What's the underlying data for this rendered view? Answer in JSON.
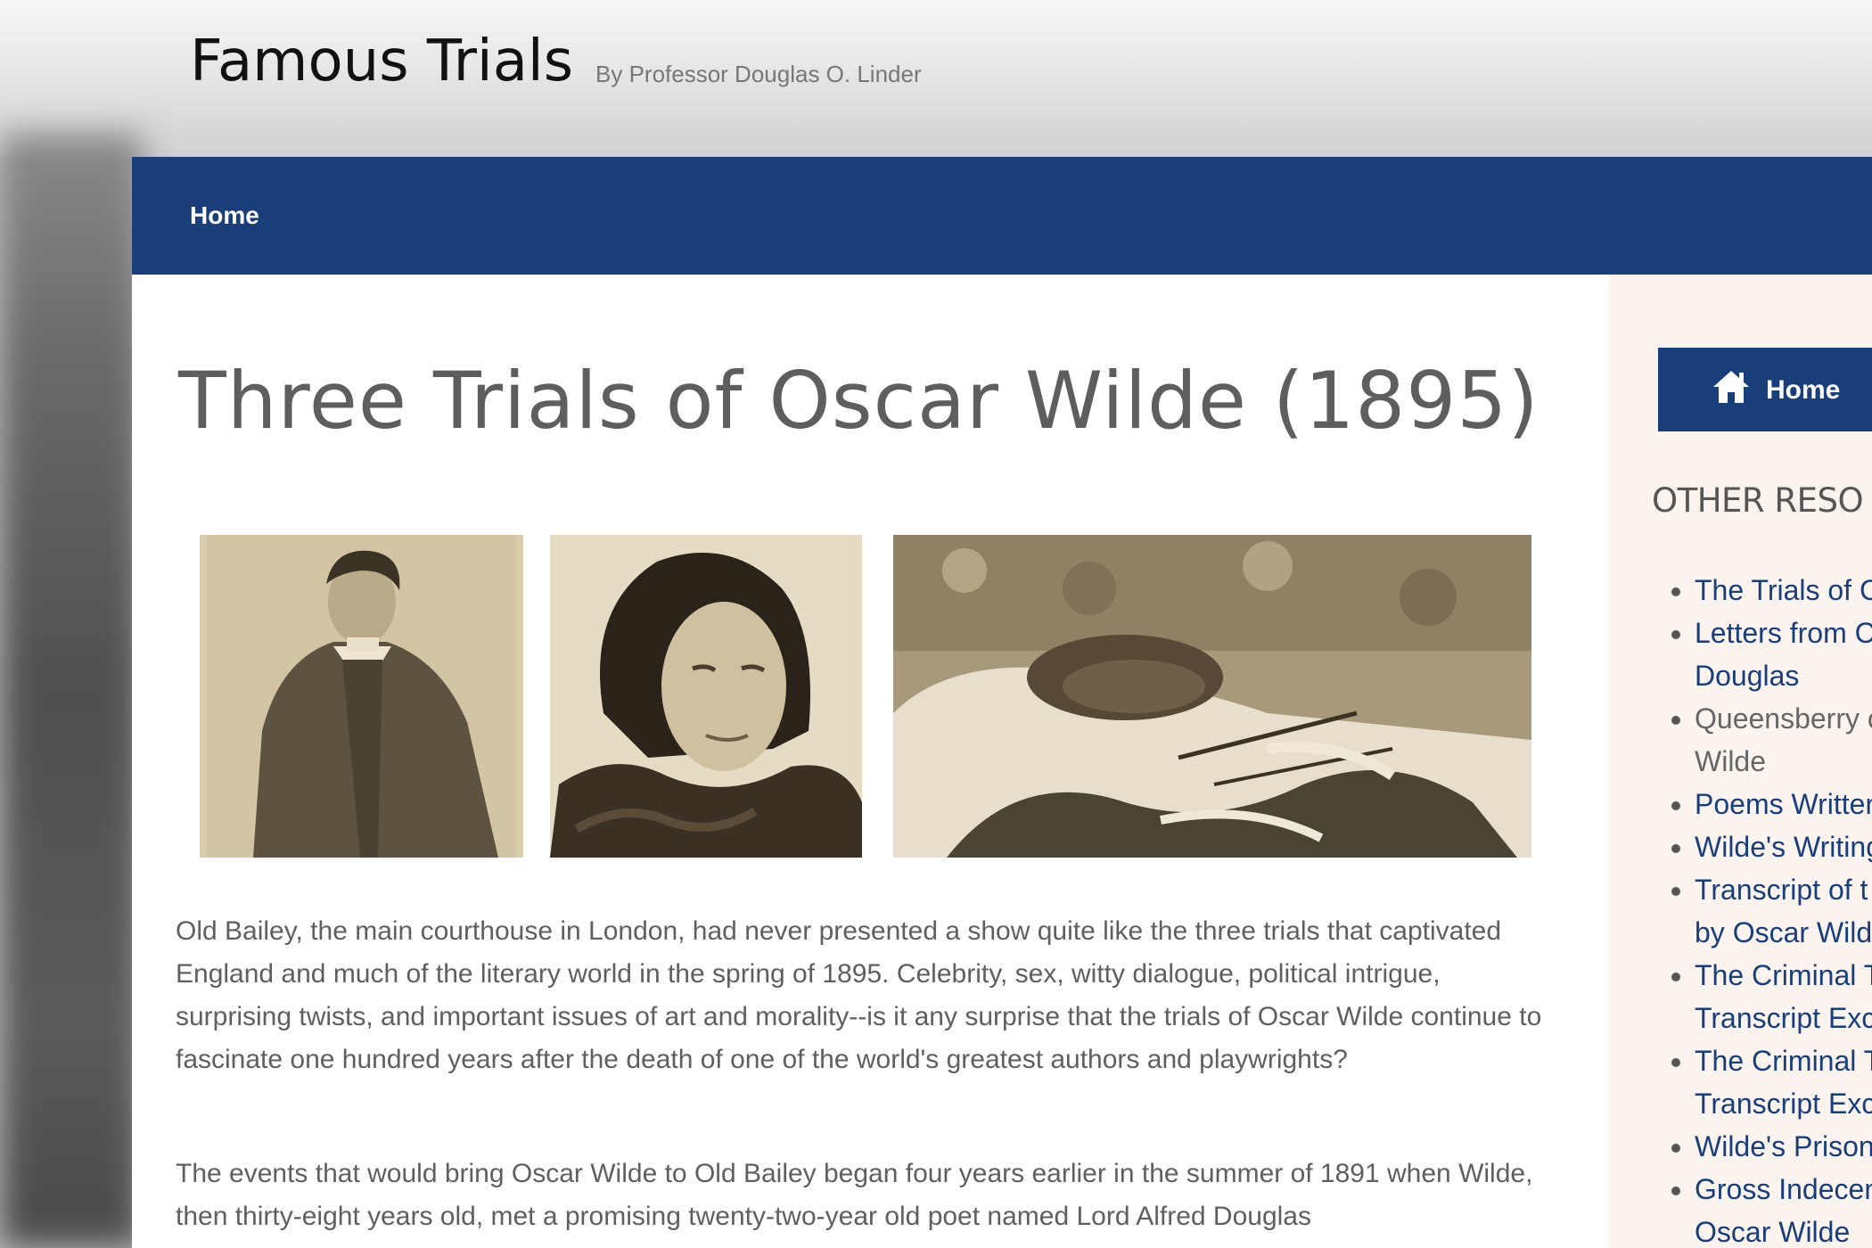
{
  "site": {
    "title": "Famous Trials",
    "tagline": "By Professor Douglas O. Linder"
  },
  "nav": {
    "home_label": "Home"
  },
  "main": {
    "title": "Three Trials of Oscar Wilde (1895)",
    "paragraphs": [
      "Old Bailey, the main courthouse in London, had never presented a show quite like the three trials that captivated England and much of the literary world in the spring of 1895. Celebrity, sex, witty dialogue, political intrigue, surprising twists, and important issues of art and morality--is it any surprise that the trials of Oscar Wilde continue to fascinate one hundred years after the death of one of the world's greatest authors and playwrights?",
      "The events that would bring Oscar Wilde to Old Bailey began four years earlier in the summer of 1891 when Wilde, then thirty-eight years old, met a promising twenty-two-year old poet named Lord Alfred Douglas"
    ]
  },
  "sidebar": {
    "home_label": "Home",
    "home_icon": "home-icon",
    "heading": "OTHER RESO",
    "items": [
      {
        "label": "The Trials of C",
        "link": true
      },
      {
        "label": "Letters from C\nDouglas",
        "link": true
      },
      {
        "label": "Queensberry c\nWilde",
        "link": false
      },
      {
        "label": "Poems Written",
        "link": true
      },
      {
        "label": "Wilde's Writing",
        "link": true
      },
      {
        "label": "Transcript of t\nby Oscar Wilde",
        "link": true
      },
      {
        "label": "The Criminal T\nTranscript Exc",
        "link": true
      },
      {
        "label": "The Criminal T\nTranscript Exc",
        "link": true
      },
      {
        "label": "Wilde's Prison",
        "link": true
      },
      {
        "label": "Gross Indecen\nOscar Wilde",
        "link": true
      }
    ]
  },
  "colors": {
    "nav_blue": "#1a3e7a",
    "sidebar_bg": "#fbf3ed",
    "body_text": "#5f5f5f"
  }
}
